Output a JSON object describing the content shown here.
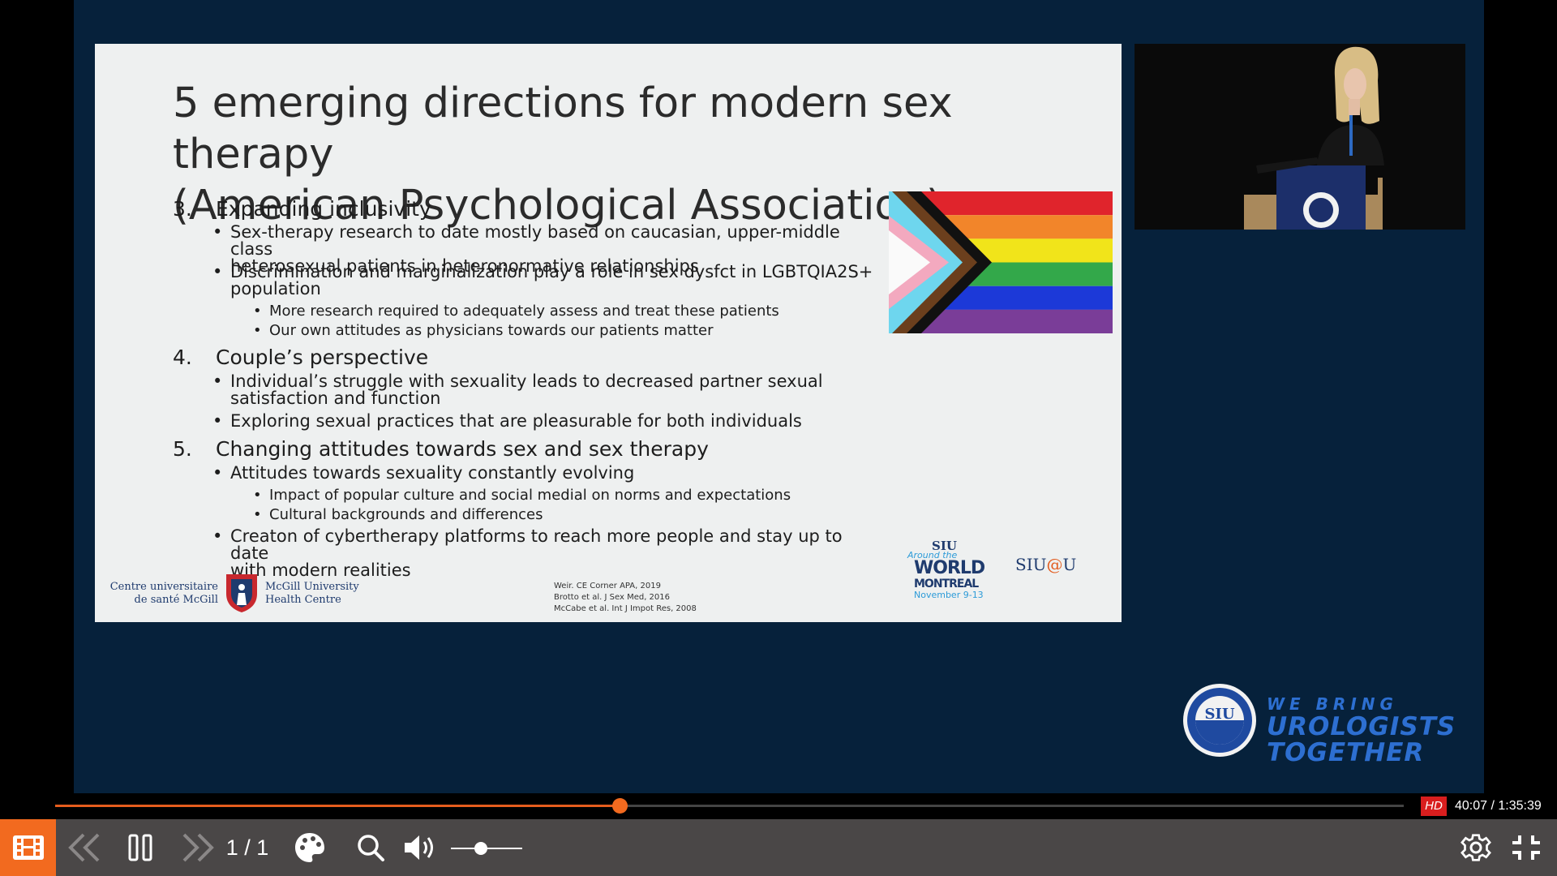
{
  "slide": {
    "title_line1": "5 emerging directions for modern sex therapy",
    "title_line2": "(American Psychological Association)",
    "sections": [
      {
        "num": "3.",
        "heading": "Expanding inclusivity"
      },
      {
        "num": "4.",
        "heading": "Couple’s perspective"
      },
      {
        "num": "5.",
        "heading": "Changing attitudes towards sex and sex therapy"
      }
    ],
    "bullets": [
      {
        "l1": "Sex-therapy research to date mostly based on caucasian, upper-middle class",
        "l2": "heterosexual patients in heteronormative relationships"
      },
      {
        "l1": "Discrimination and marginalization play a role in sex dysfct in LGBTQIA2S+",
        "l2": "population"
      },
      {
        "l1": "More research required to adequately assess and treat these patients"
      },
      {
        "l1": "Our own attitudes as physicians towards our patients matter"
      },
      {
        "l1": "Individual’s struggle with sexuality leads to decreased partner sexual",
        "l2": "satisfaction and function"
      },
      {
        "l1": "Exploring sexual practices that are pleasurable for both individuals"
      },
      {
        "l1": "Attitudes towards sexuality constantly evolving"
      },
      {
        "l1": "Impact of popular culture and social medial on norms and expectations"
      },
      {
        "l1": "Cultural backgrounds and differences"
      },
      {
        "l1": "Creaton of cybertherapy platforms to reach more people and stay up to date",
        "l2": "with modern realities"
      }
    ],
    "references": [
      "Weir. CE Corner APA, 2019",
      "Brotto et al. J Sex Med, 2016",
      "McCabe et al. Int J Impot Res, 2008"
    ],
    "logo_left": {
      "fr1": "Centre universitaire",
      "fr2": "de santé McGill",
      "en1": "McGill University",
      "en2": "Health Centre"
    },
    "siu_world": {
      "siu": "SIU",
      "around": "Around the",
      "world": "WORLD",
      "city": "MONTREAL",
      "dates": "November 9-13"
    },
    "siu_at_u": {
      "left": "SIU",
      "at": "@",
      "right": "U"
    }
  },
  "branding": {
    "line1": "WE BRING",
    "line2": "UROLOGISTS",
    "line3": "TOGETHER",
    "seal_text": "SIU"
  },
  "player": {
    "progress_fraction": 0.4187,
    "volume_fraction": 0.42,
    "hd_label": "HD",
    "time_display": "40:07 / 1:35:39",
    "page_indicator": "1 / 1"
  },
  "icons": [
    "slides-icon",
    "previous-icon",
    "pause-icon",
    "next-icon",
    "palette-icon",
    "search-icon",
    "volume-icon",
    "settings-icon",
    "exit-fullscreen-icon"
  ],
  "colors": {
    "accent": "#f26a1f",
    "hd": "#d91e1e",
    "video_bg": "#06213b",
    "controls_bg": "#4a4747"
  }
}
